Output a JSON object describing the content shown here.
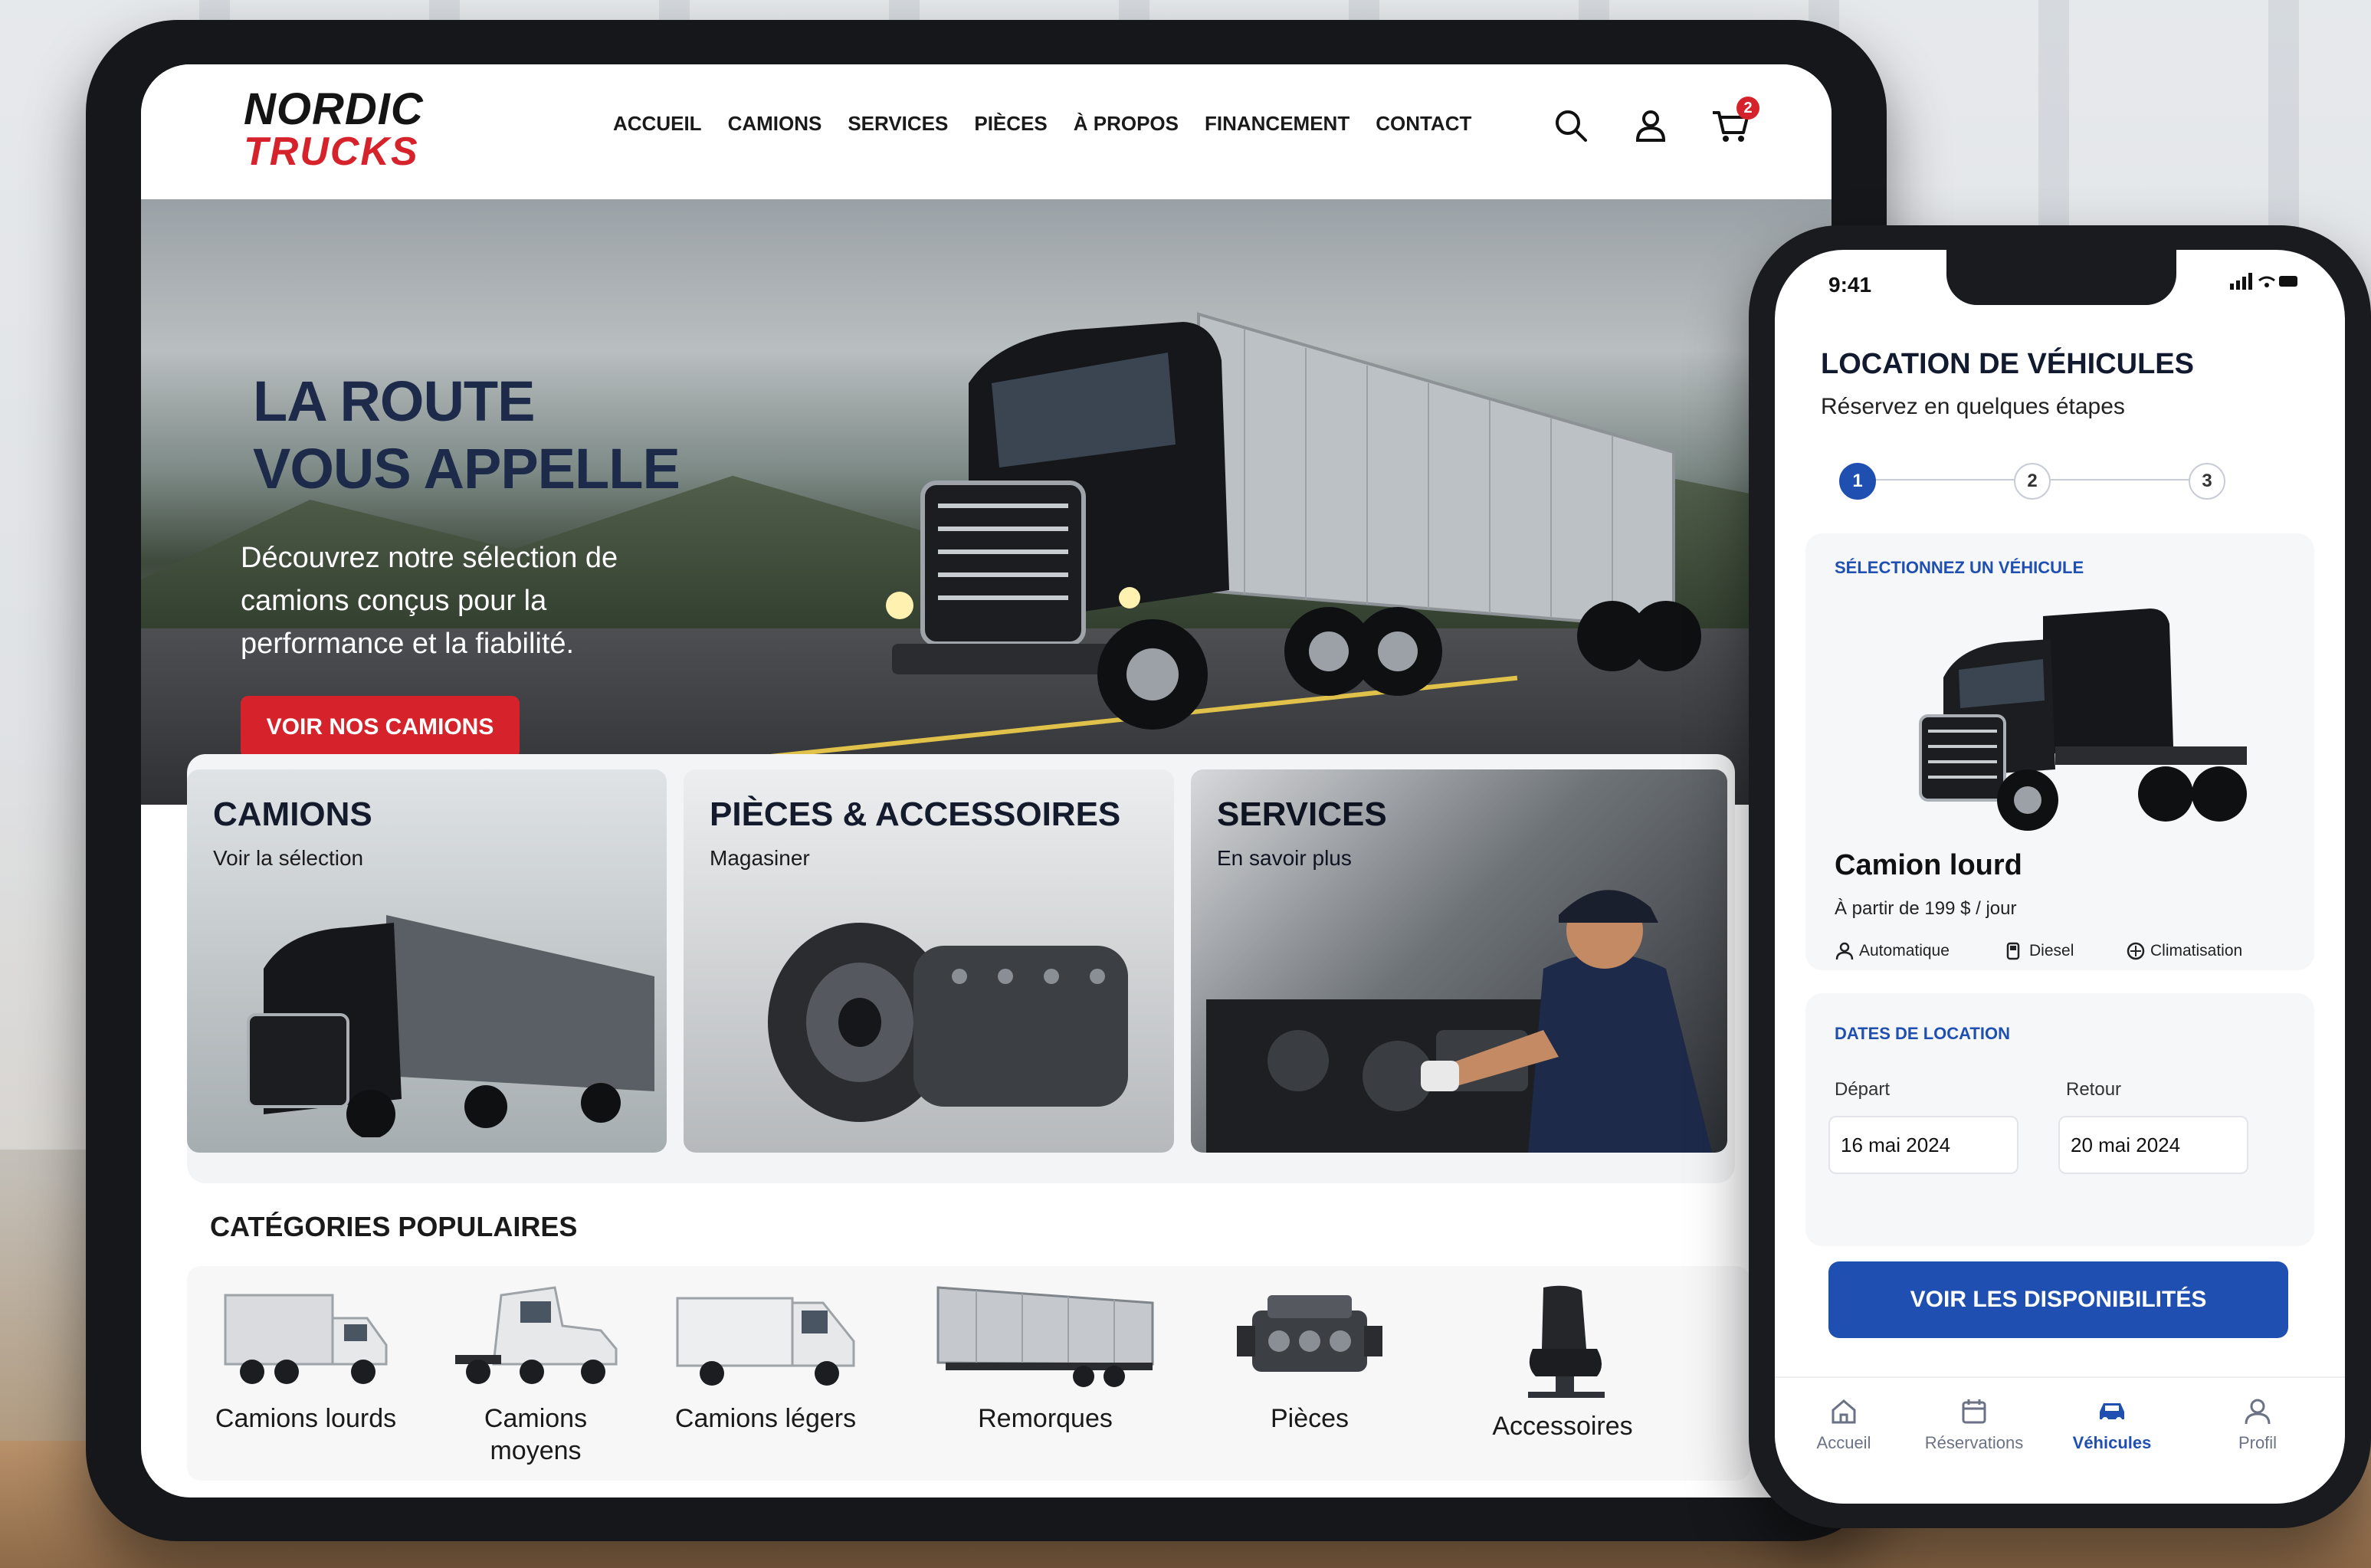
{
  "tablet": {
    "logo": {
      "line1": "NORDIC",
      "line2": "TRUCKS"
    },
    "nav": [
      "ACCUEIL",
      "CAMIONS",
      "SERVICES",
      "PIÈCES",
      "À PROPOS",
      "FINANCEMENT",
      "CONTACT"
    ],
    "icons": [
      "search-icon",
      "user-icon",
      "cart-icon"
    ],
    "cart_count": "2",
    "hero": {
      "title_line1": "LA ROUTE",
      "title_line2": "VOUS APPELLE",
      "description": "Découvrez notre sélection de camions conçus pour la performance et la fiabilité.",
      "cta": "VOIR NOS CAMIONS",
      "slides": 3,
      "active_slide": 1
    },
    "cards": [
      {
        "title": "CAMIONS",
        "subtitle": "Voir la sélection"
      },
      {
        "title": "PIÈCES & ACCESSOIRES",
        "subtitle": "Magasiner"
      },
      {
        "title": "SERVICES",
        "subtitle": "En savoir plus"
      }
    ],
    "categories_title": "CATÉGORIES POPULAIRES",
    "categories": [
      {
        "label": "Camions lourds",
        "icon": "heavy-truck-icon"
      },
      {
        "label": "Camions moyens",
        "icon": "medium-truck-icon"
      },
      {
        "label": "Camions légers",
        "icon": "light-truck-icon"
      },
      {
        "label": "Remorques",
        "icon": "trailer-icon"
      },
      {
        "label": "Pièces",
        "icon": "engine-icon"
      },
      {
        "label": "Accessoires",
        "icon": "seat-icon"
      }
    ],
    "colors": {
      "brand_red": "#d6232b",
      "navy": "#1d2a4a"
    }
  },
  "phone": {
    "time": "9:41",
    "title": "LOCATION DE VÉHICULES",
    "subtitle": "Réservez en quelques étapes",
    "steps": [
      "1",
      "2",
      "3"
    ],
    "active_step": 1,
    "select_label": "SÉLECTIONNEZ UN VÉHICULE",
    "vehicle_name": "Camion lourd",
    "vehicle_price": "À partir de 199 $ / jour",
    "features": [
      "Automatique",
      "Diesel",
      "Climatisation"
    ],
    "dates_label": "DATES DE LOCATION",
    "departure_label": "Départ",
    "departure_value": "16 mai 2024",
    "return_label": "Retour",
    "return_value": "20 mai 2024",
    "cta": "VOIR LES DISPONIBILITÉS",
    "tabs": [
      {
        "label": "Accueil",
        "icon": "home-icon"
      },
      {
        "label": "Réservations",
        "icon": "calendar-icon"
      },
      {
        "label": "Véhicules",
        "icon": "car-icon"
      },
      {
        "label": "Profil",
        "icon": "profile-icon"
      }
    ],
    "active_tab": "Véhicules",
    "colors": {
      "accent_blue": "#1f4fb0"
    }
  }
}
